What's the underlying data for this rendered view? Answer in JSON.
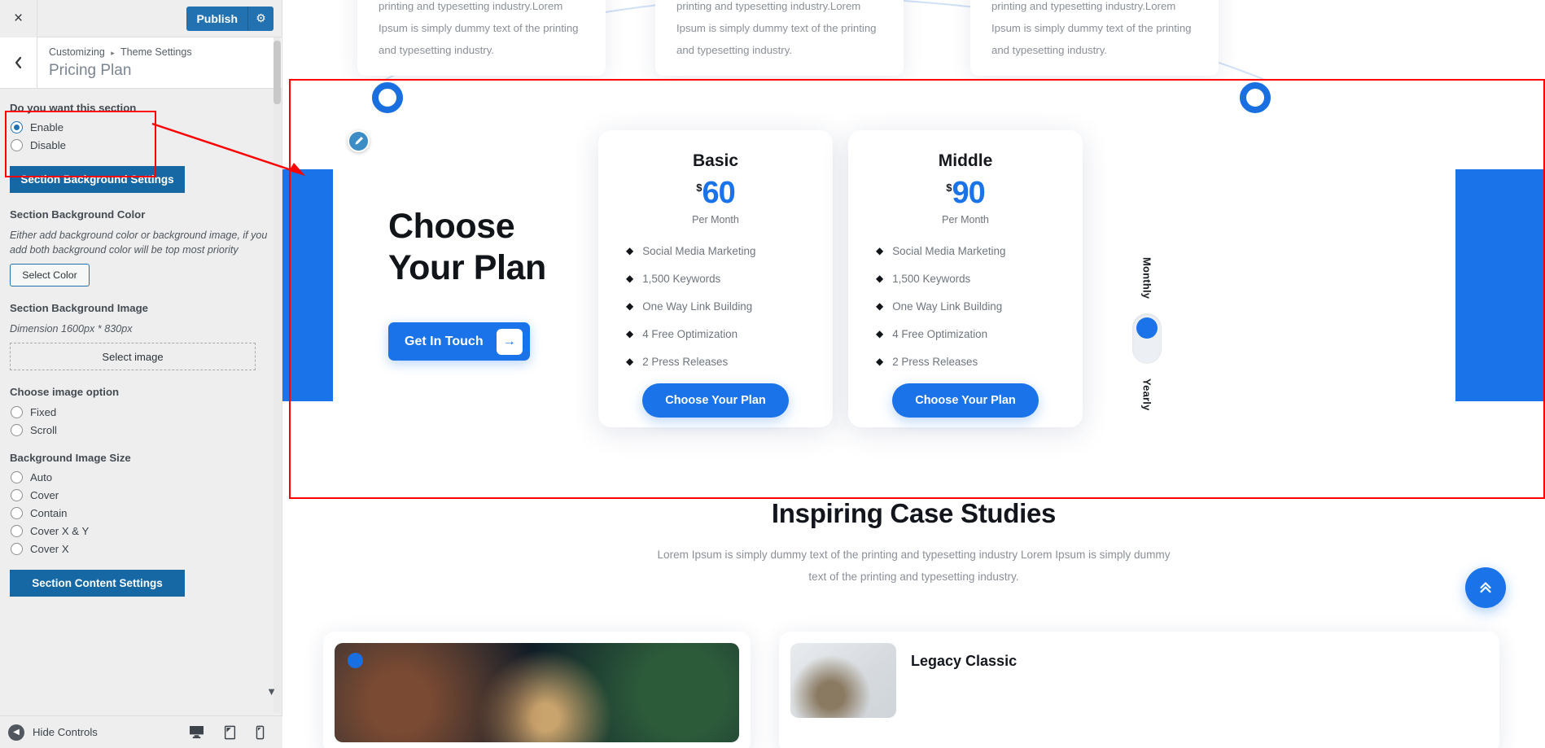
{
  "customizer": {
    "close_label": "×",
    "publish_label": "Publish",
    "gear_label": "⚙",
    "back_label": "‹",
    "breadcrumb_root": "Customizing",
    "breadcrumb_sep": "▸",
    "breadcrumb_parent": "Theme Settings",
    "section_title": "Pricing Plan",
    "enable_group": {
      "label": "Do you want this section",
      "options": [
        {
          "label": "Enable",
          "checked": true
        },
        {
          "label": "Disable",
          "checked": false
        }
      ]
    },
    "bg_settings_button": "Section Background Settings",
    "bg_color": {
      "label": "Section Background Color",
      "description": "Either add background color or background image, if you add both background color will be top most priority",
      "button": "Select Color"
    },
    "bg_image": {
      "label": "Section Background Image",
      "description": "Dimension 1600px * 830px",
      "button": "Select image"
    },
    "image_option": {
      "label": "Choose image option",
      "options": [
        {
          "label": "Fixed",
          "checked": false
        },
        {
          "label": "Scroll",
          "checked": false
        }
      ]
    },
    "image_size": {
      "label": "Background Image Size",
      "options": [
        {
          "label": "Auto",
          "checked": false
        },
        {
          "label": "Cover",
          "checked": false
        },
        {
          "label": "Contain",
          "checked": false
        },
        {
          "label": "Cover X & Y",
          "checked": false
        },
        {
          "label": "Cover X",
          "checked": false
        }
      ]
    },
    "content_settings_button": "Section Content Settings",
    "footer": {
      "hide_controls": "Hide Controls",
      "devices": [
        "desktop-icon",
        "tablet-icon",
        "mobile-icon"
      ]
    }
  },
  "preview": {
    "feature_cards": [
      {
        "text": "printing and typesetting industry.Lorem Ipsum is simply dummy text of the printing and typesetting industry."
      },
      {
        "text": "printing and typesetting industry.Lorem Ipsum is simply dummy text of the printing and typesetting industry."
      },
      {
        "text": "printing and typesetting industry.Lorem Ipsum is simply dummy text of the printing and typesetting industry."
      }
    ],
    "heading_line1": "Choose",
    "heading_line2": "Your Plan",
    "cta_label": "Get In Touch",
    "cta_arrow": "→",
    "plans": [
      {
        "name": "Basic",
        "currency": "$",
        "price": "60",
        "period": "Per Month",
        "features": [
          "Social Media Marketing",
          "1,500 Keywords",
          "One Way Link Building",
          "4 Free Optimization",
          "2 Press Releases"
        ],
        "button": "Choose Your Plan"
      },
      {
        "name": "Middle",
        "currency": "$",
        "price": "90",
        "period": "Per Month",
        "features": [
          "Social Media Marketing",
          "1,500 Keywords",
          "One Way Link Building",
          "4 Free Optimization",
          "2 Press Releases"
        ],
        "button": "Choose Your Plan"
      }
    ],
    "billing_toggle": {
      "top_label": "Monthly",
      "bottom_label": "Yearly",
      "position": "top"
    },
    "case_studies": {
      "title": "Inspiring Case Studies",
      "subtitle": "Lorem Ipsum is simply dummy text of the printing and typesetting industry Lorem Ipsum is simply dummy text of the printing and typesetting industry.",
      "right_card_title": "Legacy Classic"
    },
    "scroll_top_icon": "»",
    "accent_color": "#1a73e8",
    "annotation_color": "#ff0000"
  }
}
